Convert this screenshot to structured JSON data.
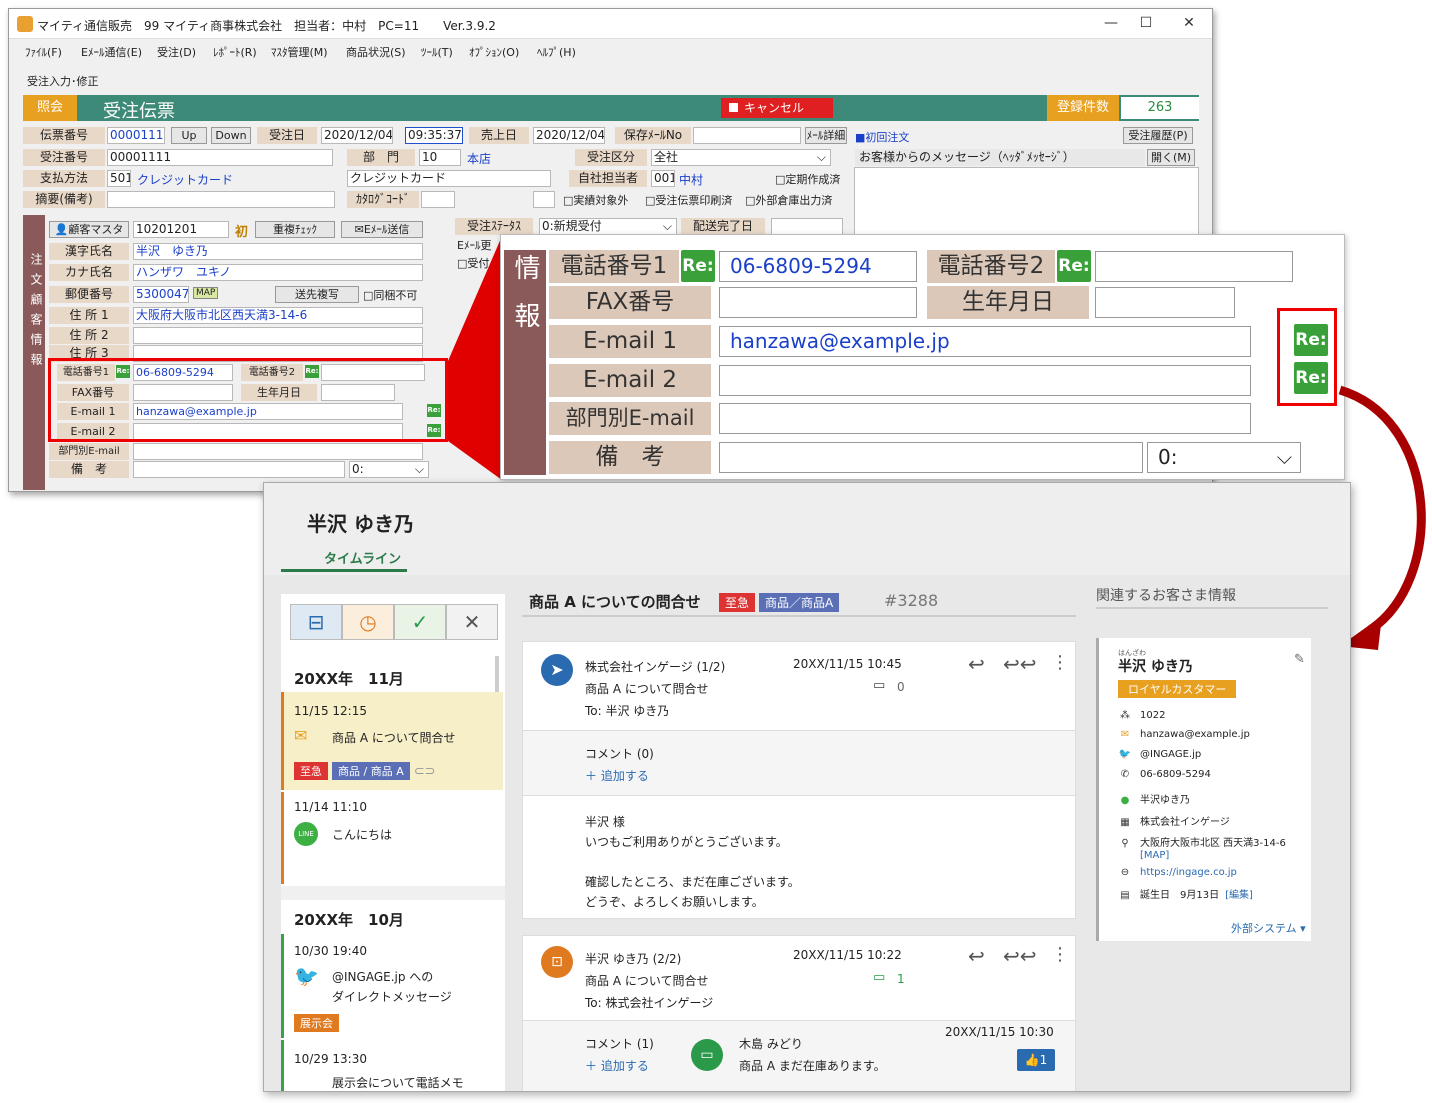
{
  "legacy": {
    "title": "マイティ通信販売　99 マイティ商事株式会社　担当者：中村　PC=11　　Ver.3.9.2",
    "window_controls": [
      "—",
      "☐",
      "✕"
    ],
    "menu": [
      "ﾌｧｲﾙ(F)",
      "Eﾒｰﾙ通信(E)",
      "受注(D)",
      "ﾚﾎﾟｰﾄ(R)",
      "ﾏｽﾀ管理(M)",
      "商品状況(S)",
      "ﾂｰﾙ(T)",
      "ｵﾌﾟｼｮﾝ(O)",
      "ﾍﾙﾌﾟ(H)"
    ],
    "crumb": "受注入力･修正",
    "mode": "照会",
    "heading": "受注伝票",
    "cancel": "キャンセル",
    "reg_label": "登録件数",
    "reg_value": "263",
    "row1": {
      "l1": "伝票番号",
      "v1": "00001111",
      "up": "Up",
      "down": "Down",
      "l2": "受注日",
      "date": "2020/12/04",
      "time": "09:35:37",
      "l3": "売上日",
      "sales_date": "2020/12/04",
      "l4": "保存ﾒｰﾙNo",
      "mail_btn": "ﾒｰﾙ詳細"
    },
    "row2": {
      "l1": "受注番号",
      "v1": "00001111",
      "l2": "部　門",
      "code": "10",
      "name": "本店",
      "l3": "受注区分",
      "sel": "全社"
    },
    "row3": {
      "l1": "支払方法",
      "code": "501",
      "pay": "クレジットカード",
      "pay2": "クレジットカード",
      "l2": "自社担当者",
      "staff_code": "001",
      "staff": "中村",
      "chk": "□定期作成済"
    },
    "row4": {
      "l1": "摘要(備考)",
      "l2": "ｶﾀﾛｸﾞｺｰﾄﾞ",
      "chk1": "□実績対象外",
      "chk2": "□受注伝票印刷済",
      "chk3": "□外部倉庫出力済"
    },
    "first_order": "■初回注文",
    "history": "受注履歴(P)",
    "msg_label": "お客様からのメッセージ（ﾍｯﾀﾞﾒｯｾｰｼﾞ）",
    "open_btn": "開く(M)",
    "sidebar": "注文顧客情報",
    "cust_btn": "顧客マスタ",
    "cust_no": "10201201",
    "first": "初",
    "dup_btn": "重複ﾁｪｯｸ",
    "email_btn": "Eﾒｰﾙ送信",
    "status_label": "受注ｽﾃｰﾀｽ",
    "status_val": "0:新規受付",
    "delivery_label": "配送完了日",
    "emod": "Eﾒｰﾙ更",
    "recv": "□受付",
    "name_l": "漢字氏名",
    "name_v": "半沢　ゆき乃",
    "kana_l": "カナ氏名",
    "kana_v": "ハンザワ　ユキノ",
    "zip_l": "郵便番号",
    "zip_v": "5300047",
    "map": "MAP",
    "send_btn": "送先複写",
    "same": "□同梱不可",
    "addr1_l": "住 所 1",
    "addr1_v": "大阪府大阪市北区西天満3-14-6",
    "addr2_l": "住 所 2",
    "addr3_l": "住 所 3",
    "tel1_l": "電話番号1",
    "tel1_v": "06-6809-5294",
    "tel2_l": "電話番号2",
    "fax_l": "FAX番号",
    "birth_l": "生年月日",
    "mail1_l": "E-mail 1",
    "mail1_v": "hanzawa@example.jp",
    "mail2_l": "E-mail 2",
    "dept_l": "部門別E-mail",
    "note_l": "備　考",
    "note_sel": "0:",
    "re": "Re:"
  },
  "zoom": {
    "side": "情報",
    "tel1": "電話番号1",
    "tel1_v": "06-6809-5294",
    "tel2": "電話番号2",
    "fax": "FAX番号",
    "birth": "生年月日",
    "mail1": "E-mail 1",
    "mail1_v": "hanzawa@example.jp",
    "mail2": "E-mail 2",
    "dept": "部門別E-mail",
    "note": "備　考",
    "note_sel": "0:",
    "re": "Re:"
  },
  "ingage": {
    "customer": "半沢 ゆき乃",
    "tab": "タイムライン",
    "filters": [
      "⊟",
      "◷",
      "✓",
      "✕"
    ],
    "month1": "20XX年　11月",
    "item1": {
      "time": "11/15 12:15",
      "text": "商品 A について問合せ",
      "tag1": "至急",
      "tag2": "商品 / 商品 A"
    },
    "item2": {
      "time": "11/14 11:10",
      "text": "こんにちは",
      "icon": "LINE"
    },
    "month2": "20XX年　10月",
    "item3": {
      "time": "10/30 19:40",
      "text1": "@INGAGE.jp への",
      "text2": "ダイレクトメッセージ",
      "tag": "展示会"
    },
    "item4": {
      "time": "10/29 13:30",
      "text": "展示会について電話メモ"
    },
    "thread_title": "商品 A についての問合せ",
    "thread_tag1": "至急",
    "thread_tag2": "商品／商品A",
    "thread_no": "#3288",
    "m1": {
      "from": "株式会社インゲージ (1/2)",
      "date": "20XX/11/15 10:45",
      "subject": "商品 A について問合せ",
      "to": "To: 半沢 ゆき乃",
      "count": "0",
      "comment": "コメント (0)",
      "add": "＋ 追加する",
      "body": [
        "半沢 様",
        "いつもご利用ありがとうございます。",
        "",
        "確認したところ、まだ在庫ございます。",
        "どうぞ、よろしくお願いします。"
      ]
    },
    "m2": {
      "from": "半沢 ゆき乃 (2/2)",
      "date": "20XX/11/15 10:22",
      "subject": "商品 A について問合せ",
      "to": "To: 株式会社インゲージ",
      "count": "1",
      "comment": "コメント (1)",
      "add": "＋ 追加する",
      "c_name": "木島 みどり",
      "c_date": "20XX/11/15 10:30",
      "c_text": "商品 A まだ在庫あります。",
      "like": "1"
    },
    "related": "関連するお客さま情報",
    "card": {
      "ruby": "はんざわ",
      "name": "半沢 ゆき乃",
      "badge": "ロイヤルカスタマー",
      "id": "1022",
      "email": "hanzawa@example.jp",
      "twitter": "@INGAGE.jp",
      "tel": "06-6809-5294",
      "line": "半沢ゆき乃",
      "company": "株式会社インゲージ",
      "address": "大阪府大阪市北区 西天満3-14-6",
      "map": "[MAP]",
      "url": "https://ingage.co.jp",
      "birthday": "誕生日　9月13日",
      "edit": "[編集]",
      "external": "外部システム ▾"
    }
  },
  "colors": {
    "green": "#3d8a78",
    "orange": "#e8a020",
    "red": "#e00000",
    "brown": "#8a5a5a",
    "tan": "#e8d8c8",
    "re": "#3aa03a",
    "urgent": "#d33",
    "product": "#5a6fb5",
    "expo": "#e07a20"
  }
}
